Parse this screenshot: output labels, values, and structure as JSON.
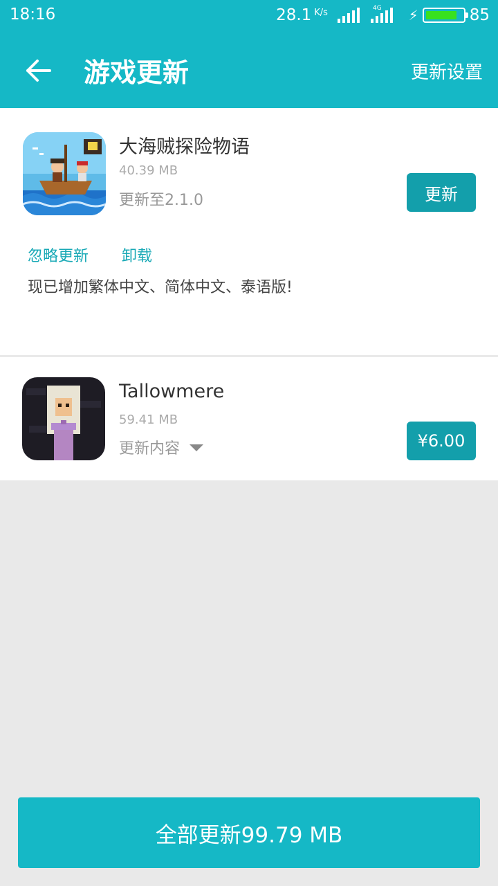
{
  "status_bar": {
    "time": "18:16",
    "speed": "28.1",
    "speed_unit": "K/s",
    "network_tag": "4G",
    "battery_level": "85",
    "battery_fraction": 0.85
  },
  "header": {
    "title": "游戏更新",
    "settings_label": "更新设置",
    "back_icon": "arrow-left-icon",
    "background": "#15b8c6"
  },
  "apps": [
    {
      "name": "大海贼探险物语",
      "size": "40.39 MB",
      "info": "更新至2.1.0",
      "action_label": "更新",
      "ignore_label": "忽略更新",
      "uninstall_label": "卸载",
      "description": "现已增加繁体中文、简体中文、泰语版!"
    },
    {
      "name": "Tallowmere",
      "size": "59.41 MB",
      "info": "更新内容",
      "action_label": "¥6.00"
    }
  ],
  "bottom": {
    "update_all_label": "全部更新99.79 MB"
  },
  "colors": {
    "accent": "#15b8c6",
    "button": "#139fab",
    "link": "#18a9b6"
  }
}
